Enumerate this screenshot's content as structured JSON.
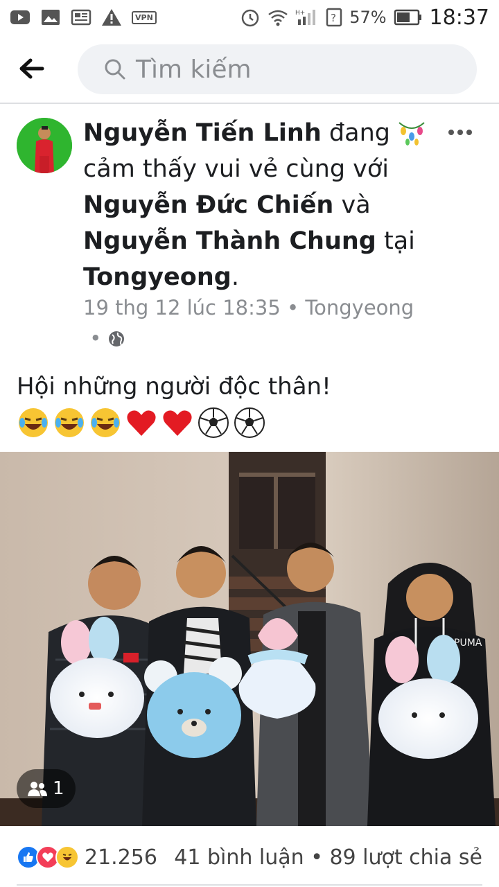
{
  "status_bar": {
    "battery_percent": "57%",
    "time": "18:37",
    "vpn": "VPN",
    "network": "H+"
  },
  "header": {
    "search_placeholder": "Tìm kiếm"
  },
  "post": {
    "author": "Nguyễn Tiến Linh",
    "feeling_text": "đang",
    "feeling_line": "cảm thấy vui vẻ cùng với",
    "tagged_1": "Nguyễn Đức Chiến",
    "and_text": "và",
    "tagged_2": "Nguyễn Thành Chung",
    "at_text": "tại",
    "location": "Tongyeong",
    "timestamp": "19 thg 12 lúc 18:35",
    "meta_location": "Tongyeong",
    "body": "Hội những người độc thân!",
    "emojis": [
      "🤣",
      "🤣",
      "🤣",
      "❤️",
      "❤️",
      "⚽",
      "⚽"
    ],
    "tag_count": "1",
    "reaction_count": "21.256",
    "comments": "41 bình luận",
    "shares": "89 lượt chia sẻ"
  }
}
